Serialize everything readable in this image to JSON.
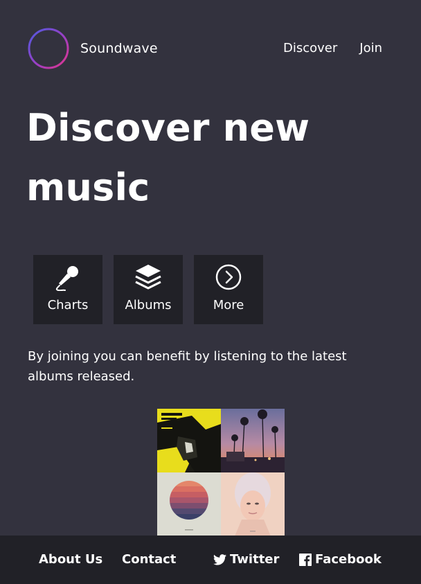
{
  "header": {
    "brand": "Soundwave",
    "logo_icon": "soundwave-logo-icon",
    "nav": [
      {
        "label": "Discover"
      },
      {
        "label": "Join"
      }
    ]
  },
  "hero": {
    "title": "Discover new music"
  },
  "tiles": [
    {
      "label": "Charts",
      "icon": "microphone-icon"
    },
    {
      "label": "Albums",
      "icon": "layers-icon"
    },
    {
      "label": "More",
      "icon": "chevron-right-circle-icon"
    }
  ],
  "description": "By joining you can benefit by listening to the latest albums released.",
  "albums": [
    {
      "name": "album-cover-1"
    },
    {
      "name": "album-cover-2"
    },
    {
      "name": "album-cover-3"
    },
    {
      "name": "album-cover-4"
    }
  ],
  "footer": {
    "about": "About Us",
    "contact": "Contact",
    "twitter": "Twitter",
    "facebook": "Facebook"
  },
  "colors": {
    "background": "#33323e",
    "panel": "#212127",
    "logo_gradient_start": "#5b4ed6",
    "logo_gradient_end": "#e0348c"
  }
}
